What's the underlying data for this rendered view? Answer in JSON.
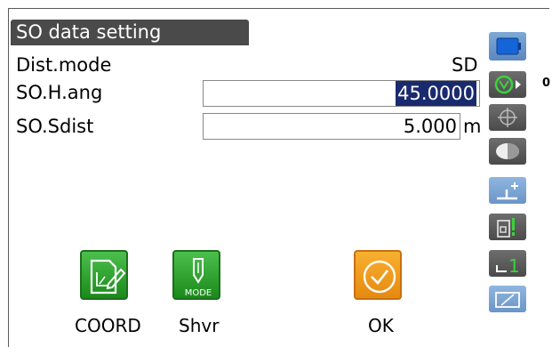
{
  "title": "SO data setting",
  "rows": {
    "dist_mode": {
      "label": "Dist.mode",
      "value": "SD"
    },
    "so_h_ang": {
      "label": "SO.H.ang",
      "value": "45.0000"
    },
    "so_sdist": {
      "label": "SO.Sdist",
      "value": "5.000",
      "unit": "m"
    }
  },
  "sidebar": {
    "target_constant": "0",
    "icons": [
      "battery-icon",
      "target-prism-icon",
      "crosshair-icon",
      "laser-icon",
      "tilt-icon",
      "input-mode-icon",
      "page-1-icon",
      "keyboard-icon"
    ],
    "page_number": "1"
  },
  "softkeys": [
    {
      "label": "COORD",
      "icon": "coord-icon",
      "color": "#2aa52a"
    },
    {
      "label": "Shvr",
      "icon": "shovel-mode-icon",
      "icon_text": "MODE",
      "color": "#2aa52a"
    },
    {
      "label": "OK",
      "icon": "ok-check-icon",
      "color": "#f0a020"
    }
  ]
}
